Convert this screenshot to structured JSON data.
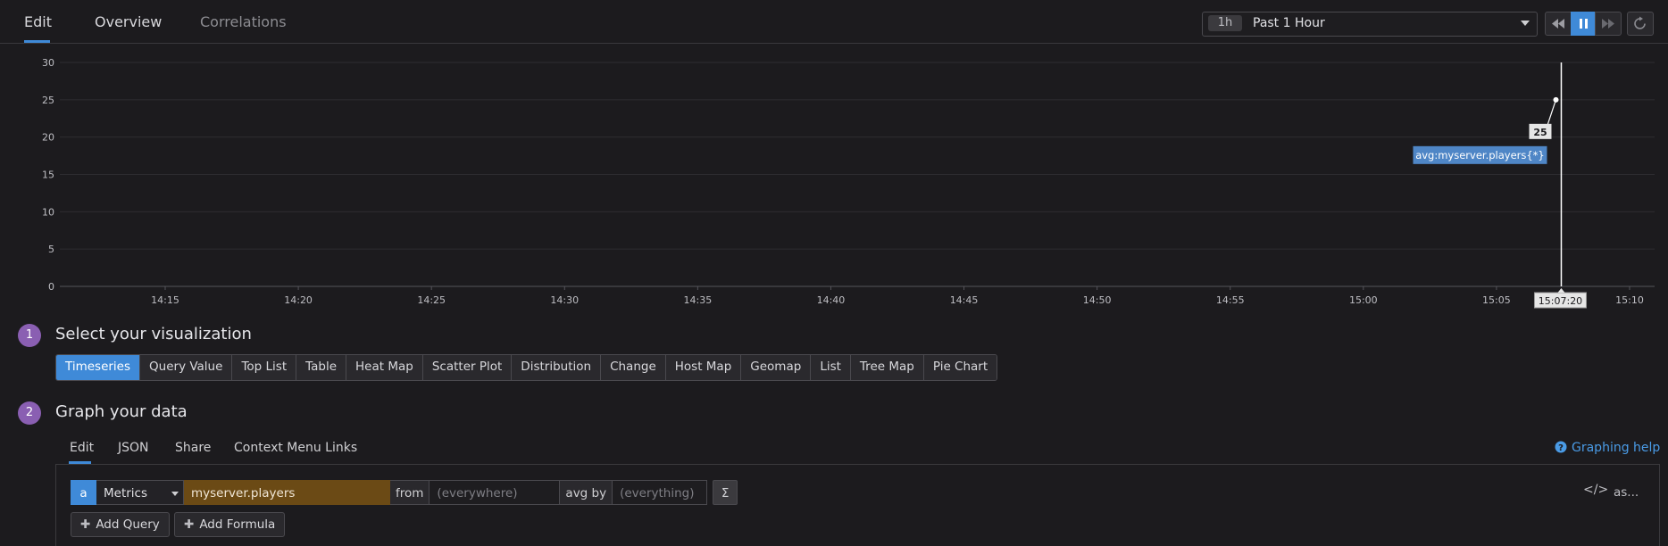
{
  "top_tabs": {
    "edit": "Edit",
    "overview": "Overview",
    "correlations": "Correlations"
  },
  "time": {
    "badge": "1h",
    "label": "Past 1 Hour"
  },
  "controls": {
    "rewind_icon": "rewind-icon",
    "pause_icon": "pause-icon",
    "forward_icon": "fast-forward-icon",
    "reset_icon": "reset-icon"
  },
  "chart_data": {
    "type": "line",
    "y_ticks": [
      "0",
      "5",
      "10",
      "15",
      "20",
      "25",
      "30"
    ],
    "ylim": [
      0,
      30
    ],
    "x_ticks": [
      "14:15",
      "14:20",
      "14:25",
      "14:30",
      "14:35",
      "14:40",
      "14:45",
      "14:50",
      "14:55",
      "15:00",
      "15:05",
      "15:10"
    ],
    "series": [
      {
        "name": "avg:myserver.players{*}",
        "x": [
          "15:07:20"
        ],
        "values": [
          25
        ]
      }
    ],
    "hover": {
      "time": "15:07:20",
      "value": "25",
      "label": "avg:myserver.players{*}"
    },
    "grid": true,
    "colors": {
      "line": "#ffffff",
      "label_bg": "#4f86c6"
    }
  },
  "step1": {
    "number": "1",
    "title": "Select your visualization"
  },
  "visualizations": [
    "Timeseries",
    "Query Value",
    "Top List",
    "Table",
    "Heat Map",
    "Scatter Plot",
    "Distribution",
    "Change",
    "Host Map",
    "Geomap",
    "List",
    "Tree Map",
    "Pie Chart"
  ],
  "step2": {
    "number": "2",
    "title": "Graph your data"
  },
  "data_tabs": {
    "edit": "Edit",
    "json": "JSON",
    "share": "Share",
    "context": "Context Menu Links"
  },
  "help": {
    "icon": "question-circle-icon",
    "label": "Graphing help"
  },
  "query": {
    "letter": "a",
    "source": "Metrics",
    "metric": "myserver.players",
    "from_label": "from",
    "from_value": "(everywhere)",
    "avg_label": "avg by",
    "avg_value": "(everything)",
    "sigma": "Σ",
    "code_icon": "</>",
    "alias": "as..."
  },
  "buttons": {
    "add_query": "Add Query",
    "add_formula": "Add Formula"
  },
  "accent": "#3f8ad8",
  "step_color": "#8a5fb2"
}
